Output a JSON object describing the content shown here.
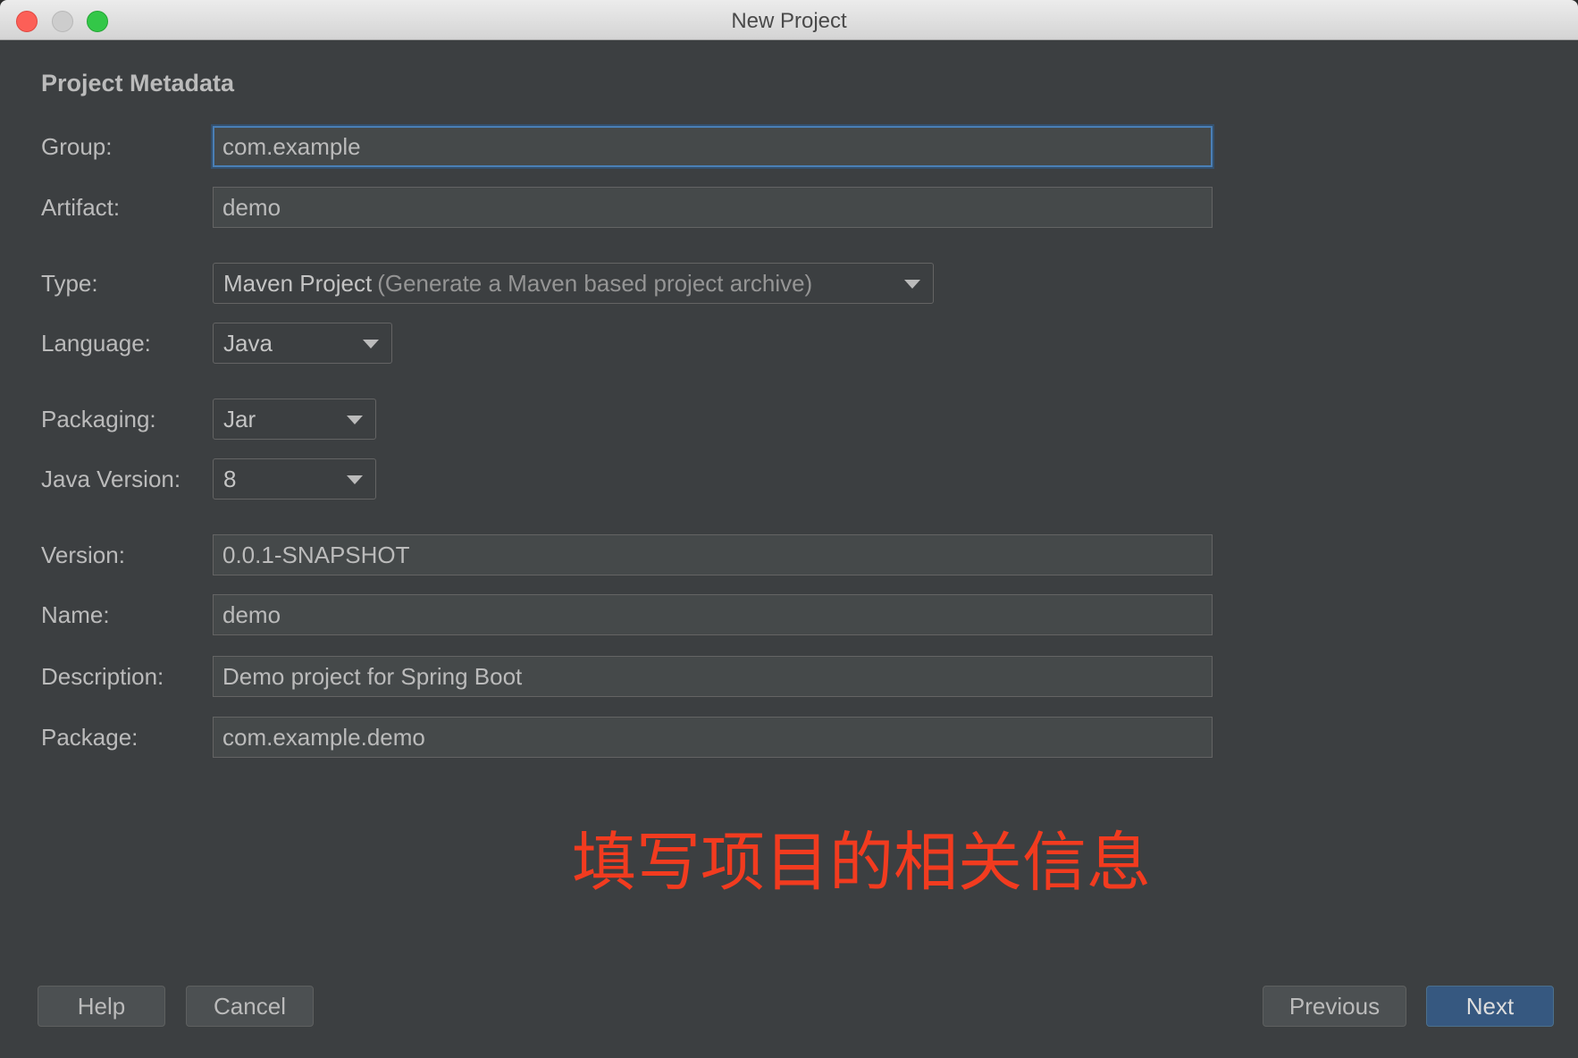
{
  "window": {
    "title": "New Project"
  },
  "section_title": "Project Metadata",
  "fields": {
    "group": {
      "label": "Group:",
      "value": "com.example"
    },
    "artifact": {
      "label": "Artifact:",
      "value": "demo"
    },
    "type": {
      "label": "Type:",
      "value": "Maven Project",
      "description": "(Generate a Maven based project archive)"
    },
    "language": {
      "label": "Language:",
      "value": "Java"
    },
    "packaging": {
      "label": "Packaging:",
      "value": "Jar"
    },
    "java_version": {
      "label": "Java Version:",
      "value": "8"
    },
    "version": {
      "label": "Version:",
      "value": "0.0.1-SNAPSHOT"
    },
    "name": {
      "label": "Name:",
      "value": "demo"
    },
    "description": {
      "label": "Description:",
      "value": "Demo project for Spring Boot"
    },
    "package": {
      "label": "Package:",
      "value": "com.example.demo"
    }
  },
  "annotation": "填写项目的相关信息",
  "buttons": {
    "help": "Help",
    "cancel": "Cancel",
    "previous": "Previous",
    "next": "Next"
  },
  "colors": {
    "background": "#3c3f41",
    "annotation": "#f23b1f",
    "primary_button": "#365880",
    "focus_border": "#4a7fb5"
  }
}
